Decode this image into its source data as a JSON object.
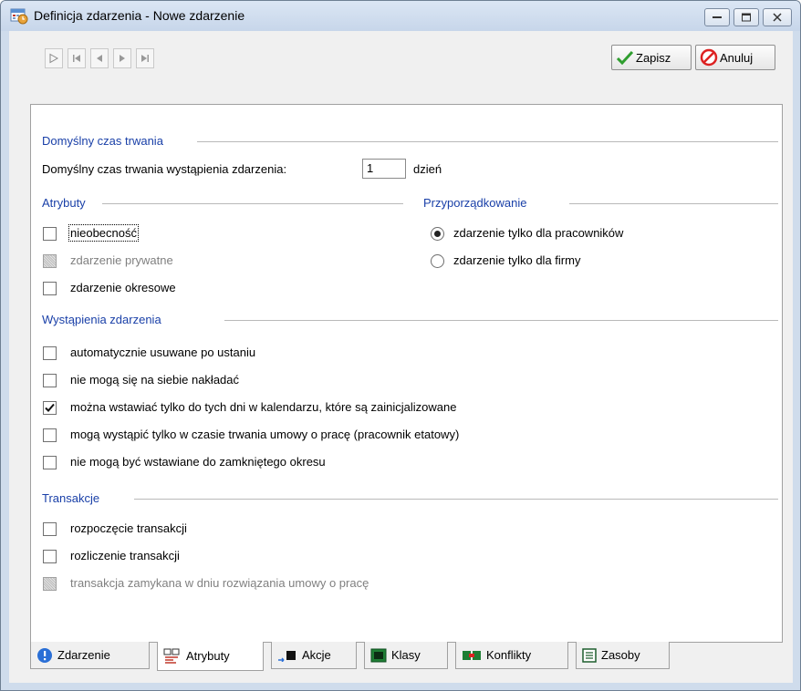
{
  "window": {
    "title": "Definicja zdarzenia - Nowe zdarzenie"
  },
  "toolbar": {
    "save_label": "Zapisz",
    "cancel_label": "Anuluj"
  },
  "default_duration": {
    "section_title": "Domyślny czas trwania",
    "label": "Domyślny czas trwania wystąpienia zdarzenia:",
    "value": "1",
    "unit": "dzień"
  },
  "attributes": {
    "section_title": "Atrybuty",
    "items": [
      {
        "label": "nieobecność",
        "checked": false,
        "enabled": true
      },
      {
        "label": "zdarzenie prywatne",
        "checked": false,
        "enabled": false
      },
      {
        "label": "zdarzenie okresowe",
        "checked": false,
        "enabled": true
      }
    ]
  },
  "assignment": {
    "section_title": "Przyporządkowanie",
    "options": [
      {
        "label": "zdarzenie tylko dla pracowników",
        "selected": true
      },
      {
        "label": "zdarzenie tylko dla firmy",
        "selected": false
      }
    ]
  },
  "occurrences": {
    "section_title": "Wystąpienia zdarzenia",
    "items": [
      {
        "label": "automatycznie usuwane po ustaniu",
        "checked": false
      },
      {
        "label": "nie mogą się na siebie nakładać",
        "checked": false
      },
      {
        "label": "można wstawiać tylko do tych dni w kalendarzu, które są zainicjalizowane",
        "checked": true
      },
      {
        "label": "mogą wystąpić tylko w czasie trwania umowy o pracę (pracownik etatowy)",
        "checked": false
      },
      {
        "label": "nie mogą być wstawiane do zamkniętego okresu",
        "checked": false
      }
    ]
  },
  "transactions": {
    "section_title": "Transakcje",
    "items": [
      {
        "label": "rozpoczęcie transakcji",
        "checked": false,
        "enabled": true
      },
      {
        "label": "rozliczenie transakcji",
        "checked": false,
        "enabled": true
      },
      {
        "label": "transakcja zamykana w dniu rozwiązania umowy o pracę",
        "checked": false,
        "enabled": false
      }
    ]
  },
  "tabs": [
    {
      "label": "Zdarzenie",
      "icon": "info-icon",
      "active": false
    },
    {
      "label": "Atrybuty",
      "icon": "attributes-icon",
      "active": true
    },
    {
      "label": "Akcje",
      "icon": "actions-icon",
      "active": false
    },
    {
      "label": "Klasy",
      "icon": "classes-icon",
      "active": false
    },
    {
      "label": "Konflikty",
      "icon": "conflicts-icon",
      "active": false
    },
    {
      "label": "Zasoby",
      "icon": "resources-icon",
      "active": false
    }
  ],
  "colors": {
    "section_title": "#1a40a8",
    "title_bar": "#cfdcec"
  }
}
